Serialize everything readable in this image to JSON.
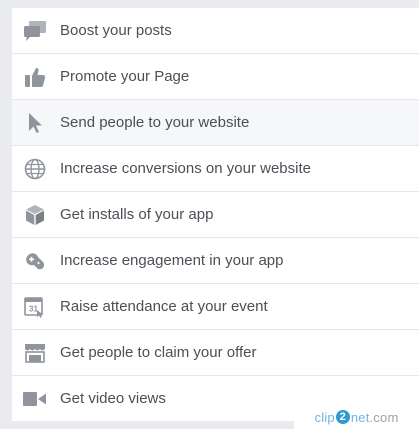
{
  "menu": {
    "items": [
      {
        "label": "Boost your posts",
        "icon": "speech-bubbles-icon"
      },
      {
        "label": "Promote your Page",
        "icon": "thumbs-up-icon"
      },
      {
        "label": "Send people to your website",
        "icon": "cursor-icon",
        "active": true
      },
      {
        "label": "Increase conversions on your website",
        "icon": "globe-icon"
      },
      {
        "label": "Get installs of your app",
        "icon": "cube-icon"
      },
      {
        "label": "Increase engagement in your app",
        "icon": "gamepad-icon"
      },
      {
        "label": "Raise attendance at your event",
        "icon": "calendar-icon"
      },
      {
        "label": "Get people to claim your offer",
        "icon": "storefront-icon"
      },
      {
        "label": "Get video views",
        "icon": "video-camera-icon"
      }
    ]
  },
  "colors": {
    "background": "#e9ebee",
    "panel": "#ffffff",
    "text": "#4b4f56",
    "icon": "#90949c",
    "active_row": "#f6f7f9",
    "divider": "#e5e6e9"
  },
  "watermark": {
    "prefix": "clip",
    "accent": "2",
    "middle": "net",
    "suffix": ".com"
  }
}
